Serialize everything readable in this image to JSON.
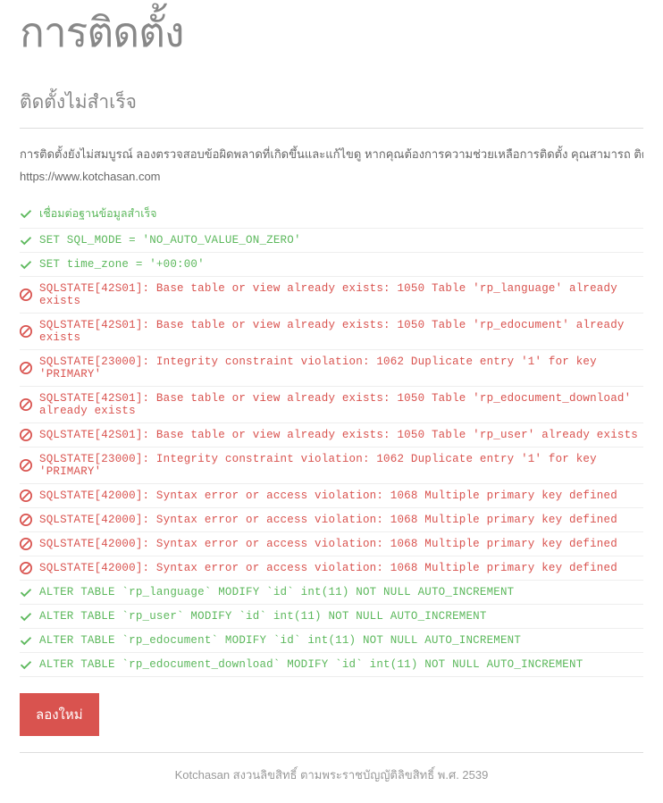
{
  "pageTitle": "การติดตั้ง",
  "subtitle": "ติดตั้งไม่สำเร็จ",
  "description": "การติดตั้งยังไม่สมบูรณ์ ลองตรวจสอบข้อผิดพลาดที่เกิดขึ้นและแก้ไขดู หากคุณต้องการความช่วยเหลือการติดตั้ง คุณสามารถ ติดต่อสอบถามไ",
  "url": "https://www.kotchasan.com",
  "logs": [
    {
      "status": "success",
      "text": "เชื่อมต่อฐานข้อมูลสำเร็จ",
      "thai": true
    },
    {
      "status": "success",
      "text": "SET SQL_MODE = 'NO_AUTO_VALUE_ON_ZERO'"
    },
    {
      "status": "success",
      "text": "SET time_zone = '+00:00'"
    },
    {
      "status": "error",
      "text": "SQLSTATE[42S01]: Base table or view already exists: 1050 Table 'rp_language' already exists"
    },
    {
      "status": "error",
      "text": "SQLSTATE[42S01]: Base table or view already exists: 1050 Table 'rp_edocument' already exists"
    },
    {
      "status": "error",
      "text": "SQLSTATE[23000]: Integrity constraint violation: 1062 Duplicate entry '1' for key 'PRIMARY'"
    },
    {
      "status": "error",
      "text": "SQLSTATE[42S01]: Base table or view already exists: 1050 Table 'rp_edocument_download' already exists"
    },
    {
      "status": "error",
      "text": "SQLSTATE[42S01]: Base table or view already exists: 1050 Table 'rp_user' already exists"
    },
    {
      "status": "error",
      "text": "SQLSTATE[23000]: Integrity constraint violation: 1062 Duplicate entry '1' for key 'PRIMARY'"
    },
    {
      "status": "error",
      "text": "SQLSTATE[42000]: Syntax error or access violation: 1068 Multiple primary key defined"
    },
    {
      "status": "error",
      "text": "SQLSTATE[42000]: Syntax error or access violation: 1068 Multiple primary key defined"
    },
    {
      "status": "error",
      "text": "SQLSTATE[42000]: Syntax error or access violation: 1068 Multiple primary key defined"
    },
    {
      "status": "error",
      "text": "SQLSTATE[42000]: Syntax error or access violation: 1068 Multiple primary key defined"
    },
    {
      "status": "success",
      "text": "ALTER TABLE `rp_language` MODIFY `id` int(11) NOT NULL AUTO_INCREMENT"
    },
    {
      "status": "success",
      "text": "ALTER TABLE `rp_user` MODIFY `id` int(11) NOT NULL AUTO_INCREMENT"
    },
    {
      "status": "success",
      "text": "ALTER TABLE `rp_edocument` MODIFY `id` int(11) NOT NULL AUTO_INCREMENT"
    },
    {
      "status": "success",
      "text": "ALTER TABLE `rp_edocument_download` MODIFY `id` int(11) NOT NULL AUTO_INCREMENT"
    }
  ],
  "retryButton": "ลองใหม่",
  "footer": "Kotchasan สงวนลิขสิทธิ์ ตามพระราชบัญญัติลิขสิทธิ์ พ.ศ. 2539"
}
